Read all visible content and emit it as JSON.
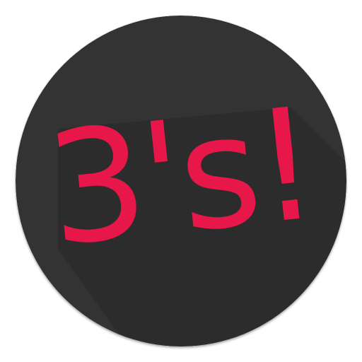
{
  "icon": {
    "logo_text": "3's!",
    "colors": {
      "background": "#333333",
      "text": "#e8174a",
      "long_shadow": "#262626"
    }
  }
}
